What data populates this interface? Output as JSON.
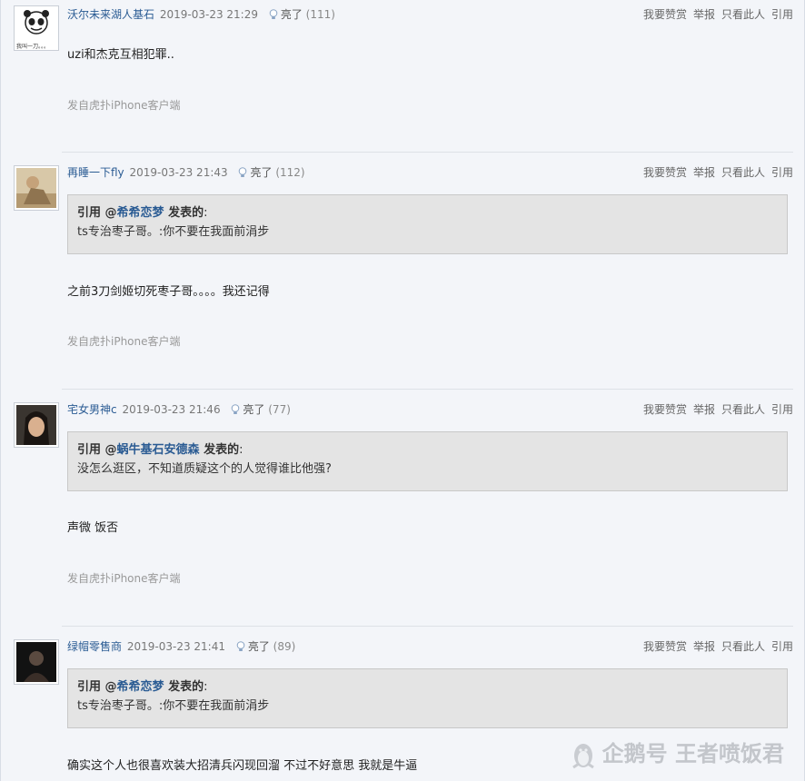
{
  "posts": [
    {
      "username": "沃尔未来湖人基石",
      "time": "2019-03-23 21:29",
      "light_label": "亮了",
      "light_count": "(111)",
      "avatar_icon": "panda-meme-avatar",
      "avatar_caption": "我叫一刀。。。",
      "actions": [
        "我要赞赏",
        "举报",
        "只看此人",
        "引用"
      ],
      "quote": null,
      "body": "uzi和杰克互相犯罪..",
      "source": "发自虎扑iPhone客户端"
    },
    {
      "username": "再睡一下fly",
      "time": "2019-03-23 21:43",
      "light_label": "亮了",
      "light_count": "(112)",
      "avatar_icon": "photo-avatar",
      "actions": [
        "我要赞赏",
        "举报",
        "只看此人",
        "引用"
      ],
      "quote": {
        "prefix": "引用 @",
        "user": "希希恋梦",
        "suffix": " 发表的",
        "colon": ":",
        "text": "ts专治枣子哥。:你不要在我面前涓步"
      },
      "body": "之前3刀剑姬切死枣子哥。。。。我还记得",
      "source": "发自虎扑iPhone客户端"
    },
    {
      "username": "宅女男神c",
      "time": "2019-03-23 21:46",
      "light_label": "亮了",
      "light_count": "(77)",
      "avatar_icon": "anime-avatar",
      "actions": [
        "我要赞赏",
        "举报",
        "只看此人",
        "引用"
      ],
      "quote": {
        "prefix": "引用 @",
        "user": "蜗牛基石安德森",
        "suffix": " 发表的",
        "colon": ":",
        "text": "没怎么逛区，不知道质疑这个的人觉得谁比他强?"
      },
      "body": "声微 饭否",
      "source": "发自虎扑iPhone客户端"
    },
    {
      "username": "绿帽零售商",
      "time": "2019-03-23 21:41",
      "light_label": "亮了",
      "light_count": "(89)",
      "avatar_icon": "dark-photo-avatar",
      "actions": [
        "我要赞赏",
        "举报",
        "只看此人",
        "引用"
      ],
      "quote": {
        "prefix": "引用 @",
        "user": "希希恋梦",
        "suffix": " 发表的",
        "colon": ":",
        "text": "ts专治枣子哥。:你不要在我面前涓步"
      },
      "body": "确实这个人也很喜欢装大招清兵闪现回溜 不过不好意思 我就是牛逼",
      "source": ""
    }
  ],
  "watermark": {
    "icon": "penguin-icon",
    "text": "企鹅号 王者喷饭君"
  },
  "colors": {
    "background": "#f3f5f9",
    "link": "#2a5b93",
    "quote_bg": "#e4e4e4",
    "muted": "#999999"
  }
}
